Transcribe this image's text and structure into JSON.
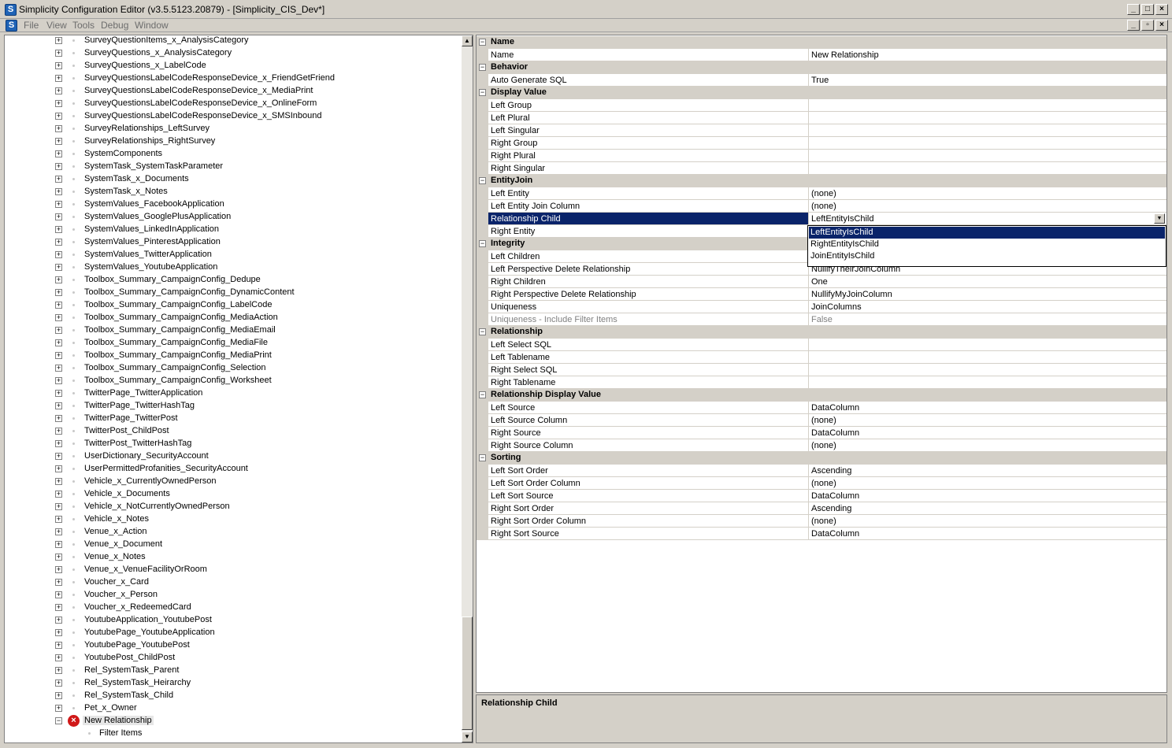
{
  "window": {
    "title": "Simplicity Configuration Editor (v3.5.5123.20879) - [Simplicity_CIS_Dev*]",
    "icon_letter": "S"
  },
  "menu": [
    "File",
    "View",
    "Tools",
    "Debug",
    "Window"
  ],
  "tree": {
    "items": [
      "SurveyQuestionItems_x_AnalysisCategory",
      "SurveyQuestions_x_AnalysisCategory",
      "SurveyQuestions_x_LabelCode",
      "SurveyQuestionsLabelCodeResponseDevice_x_FriendGetFriend",
      "SurveyQuestionsLabelCodeResponseDevice_x_MediaPrint",
      "SurveyQuestionsLabelCodeResponseDevice_x_OnlineForm",
      "SurveyQuestionsLabelCodeResponseDevice_x_SMSInbound",
      "SurveyRelationships_LeftSurvey",
      "SurveyRelationships_RightSurvey",
      "SystemComponents",
      "SystemTask_SystemTaskParameter",
      "SystemTask_x_Documents",
      "SystemTask_x_Notes",
      "SystemValues_FacebookApplication",
      "SystemValues_GooglePlusApplication",
      "SystemValues_LinkedInApplication",
      "SystemValues_PinterestApplication",
      "SystemValues_TwitterApplication",
      "SystemValues_YoutubeApplication",
      "Toolbox_Summary_CampaignConfig_Dedupe",
      "Toolbox_Summary_CampaignConfig_DynamicContent",
      "Toolbox_Summary_CampaignConfig_LabelCode",
      "Toolbox_Summary_CampaignConfig_MediaAction",
      "Toolbox_Summary_CampaignConfig_MediaEmail",
      "Toolbox_Summary_CampaignConfig_MediaFile",
      "Toolbox_Summary_CampaignConfig_MediaPrint",
      "Toolbox_Summary_CampaignConfig_Selection",
      "Toolbox_Summary_CampaignConfig_Worksheet",
      "TwitterPage_TwitterApplication",
      "TwitterPage_TwitterHashTag",
      "TwitterPage_TwitterPost",
      "TwitterPost_ChildPost",
      "TwitterPost_TwitterHashTag",
      "UserDictionary_SecurityAccount",
      "UserPermittedProfanities_SecurityAccount",
      "Vehicle_x_CurrentlyOwnedPerson",
      "Vehicle_x_Documents",
      "Vehicle_x_NotCurrentlyOwnedPerson",
      "Vehicle_x_Notes",
      "Venue_x_Action",
      "Venue_x_Document",
      "Venue_x_Notes",
      "Venue_x_VenueFacilityOrRoom",
      "Voucher_x_Card",
      "Voucher_x_Person",
      "Voucher_x_RedeemedCard",
      "YoutubeApplication_YoutubePost",
      "YoutubePage_YoutubeApplication",
      "YoutubePage_YoutubePost",
      "YoutubePost_ChildPost",
      "Rel_SystemTask_Parent",
      "Rel_SystemTask_Heirarchy",
      "Rel_SystemTask_Child",
      "Pet_x_Owner"
    ],
    "selected_item": "New Relationship",
    "child_item": "Filter Items"
  },
  "properties": {
    "categories": [
      {
        "name": "Name",
        "rows": [
          {
            "name": "Name",
            "value": "New Relationship"
          }
        ]
      },
      {
        "name": "Behavior",
        "rows": [
          {
            "name": "Auto Generate SQL",
            "value": "True"
          }
        ]
      },
      {
        "name": "Display Value",
        "rows": [
          {
            "name": "Left Group",
            "value": ""
          },
          {
            "name": "Left Plural",
            "value": ""
          },
          {
            "name": "Left Singular",
            "value": ""
          },
          {
            "name": "Right Group",
            "value": ""
          },
          {
            "name": "Right Plural",
            "value": ""
          },
          {
            "name": "Right Singular",
            "value": ""
          }
        ]
      },
      {
        "name": "EntityJoin",
        "rows": [
          {
            "name": "Left Entity",
            "value": "(none)"
          },
          {
            "name": "Left Entity Join Column",
            "value": "(none)"
          },
          {
            "name": "Relationship Child",
            "value": "LeftEntityIsChild",
            "selected": true
          },
          {
            "name": "Right Entity",
            "value": ""
          }
        ]
      },
      {
        "name": "Integrity",
        "rows": [
          {
            "name": "Left Children",
            "value": ""
          },
          {
            "name": "Left Perspective Delete Relationship",
            "value": "NullifyTheirJoinColumn"
          },
          {
            "name": "Right Children",
            "value": "One"
          },
          {
            "name": "Right Perspective Delete Relationship",
            "value": "NullifyMyJoinColumn"
          },
          {
            "name": "Uniqueness",
            "value": "JoinColumns"
          },
          {
            "name": "Uniqueness - Include Filter Items",
            "value": "False",
            "disabled": true
          }
        ]
      },
      {
        "name": "Relationship",
        "rows": [
          {
            "name": "Left Select SQL",
            "value": ""
          },
          {
            "name": "Left Tablename",
            "value": ""
          },
          {
            "name": "Right Select SQL",
            "value": ""
          },
          {
            "name": "Right Tablename",
            "value": ""
          }
        ]
      },
      {
        "name": "Relationship Display Value",
        "rows": [
          {
            "name": "Left Source",
            "value": "DataColumn"
          },
          {
            "name": "Left Source Column",
            "value": "(none)"
          },
          {
            "name": "Right Source",
            "value": "DataColumn"
          },
          {
            "name": "Right Source Column",
            "value": "(none)"
          }
        ]
      },
      {
        "name": "Sorting",
        "rows": [
          {
            "name": "Left Sort Order",
            "value": "Ascending"
          },
          {
            "name": "Left Sort Order Column",
            "value": "(none)"
          },
          {
            "name": "Left Sort Source",
            "value": "DataColumn"
          },
          {
            "name": "Right Sort Order",
            "value": "Ascending"
          },
          {
            "name": "Right Sort Order Column",
            "value": "(none)"
          },
          {
            "name": "Right Sort Source",
            "value": "DataColumn"
          }
        ]
      }
    ]
  },
  "dropdown": {
    "options": [
      "LeftEntityIsChild",
      "RightEntityIsChild",
      "JoinEntityIsChild"
    ],
    "selected_index": 0
  },
  "description": {
    "title": "Relationship Child"
  },
  "colors": {
    "selection": "#0a246a",
    "chrome": "#d4d0c8",
    "error": "#d01818"
  }
}
